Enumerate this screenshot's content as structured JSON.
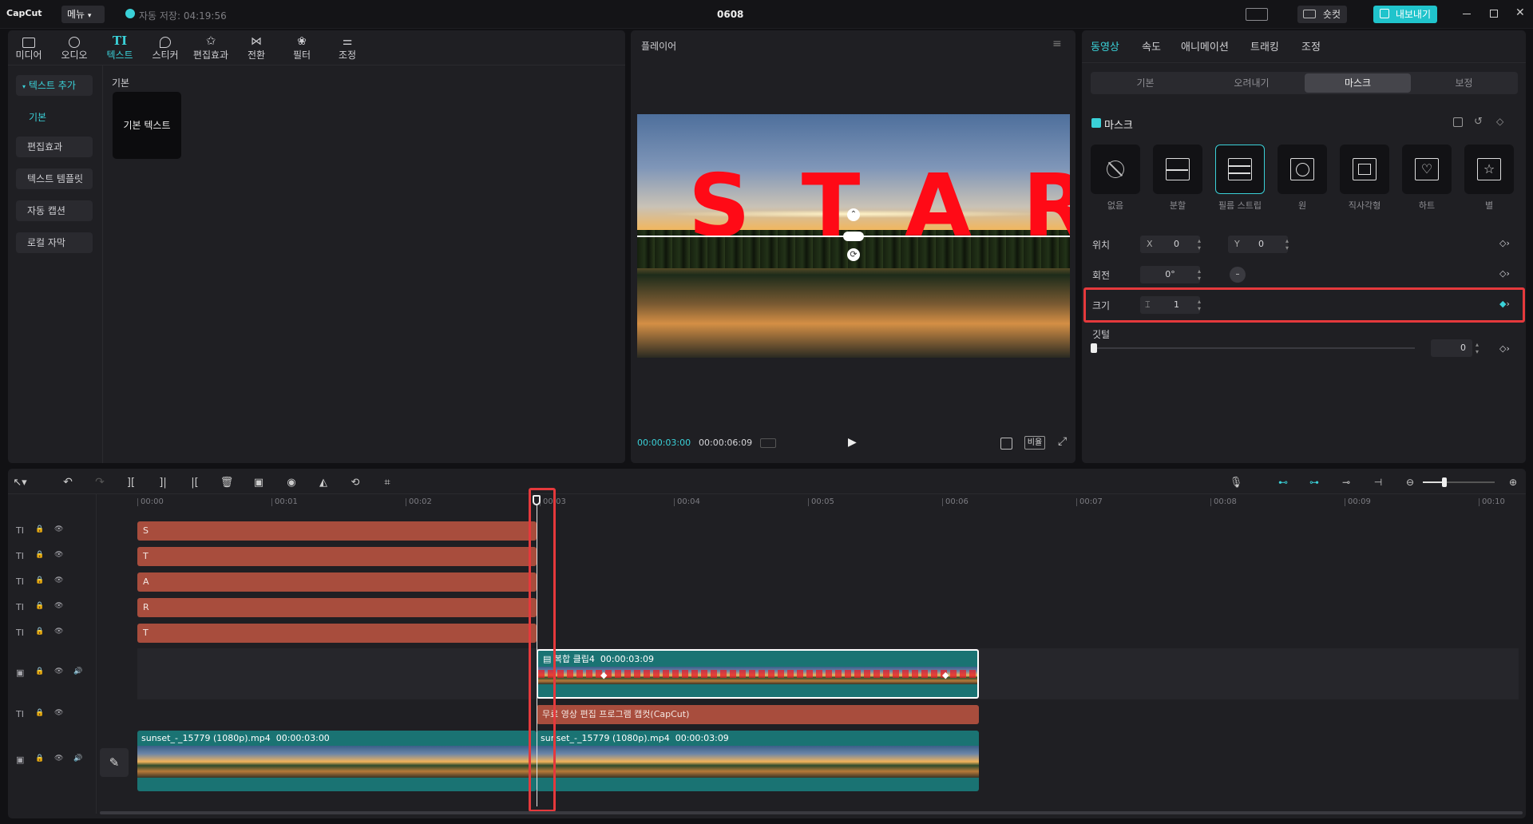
{
  "app": {
    "logo": "CapCut",
    "menu_label": "메뉴",
    "autosave": "자동 저장: 04:19:56",
    "project_title": "0608",
    "shortcut_label": "숏컷",
    "export_label": "내보내기"
  },
  "toolbar": [
    {
      "label": "미디어"
    },
    {
      "label": "오디오"
    },
    {
      "label": "텍스트"
    },
    {
      "label": "스티커"
    },
    {
      "label": "편집효과"
    },
    {
      "label": "전환"
    },
    {
      "label": "필터"
    },
    {
      "label": "조정"
    }
  ],
  "left_sidebar": {
    "items": [
      "텍스트 추가",
      "기본",
      "편집효과",
      "텍스트 템플릿",
      "자동 캡션",
      "로컬 자막"
    ]
  },
  "text_panel": {
    "section_title": "기본",
    "card_label": "기본 텍스트"
  },
  "player": {
    "title": "플레이어",
    "overlay_text": "START",
    "current_time": "00:00:03:00",
    "total_time": "00:00:06:09",
    "ratio_label": "비율"
  },
  "props": {
    "tabs": [
      "동영상",
      "속도",
      "애니메이션",
      "트래킹",
      "조정"
    ],
    "subtabs": [
      "기본",
      "오려내기",
      "마스크",
      "보정"
    ],
    "mask_title": "마스크",
    "shapes": [
      "없음",
      "분할",
      "필름 스트립",
      "원",
      "직사각형",
      "하트",
      "별"
    ],
    "position_label": "위치",
    "x_label": "X",
    "x_value": "0",
    "y_label": "Y",
    "y_value": "0",
    "rotation_label": "회전",
    "rotation_value": "0°",
    "size_label": "크기",
    "size_value": "1",
    "feather_label": "깃털",
    "feather_value": "0"
  },
  "timeline": {
    "ruler": [
      "00:00",
      "00:01",
      "00:02",
      "00:03",
      "00:04",
      "00:05",
      "00:06",
      "00:07",
      "00:08",
      "00:09",
      "00:10"
    ],
    "text_clips": [
      "S",
      "T",
      "A",
      "R",
      "T"
    ],
    "compound_label": "복합 클립4",
    "compound_duration": "00:00:03:09",
    "subtitle_clip": "무료 영상 편집 프로그램 캡컷(CapCut)",
    "video1_name": "sunset_-_15779 (1080p).mp4",
    "video1_duration": "00:00:03:00",
    "video2_name": "sunset_-_15779 (1080p).mp4",
    "video2_duration": "00:00:03:09",
    "playhead_time": "00:00:03:00"
  },
  "colors": {
    "accent": "#3ad1d8",
    "highlight": "#e5393c",
    "text_clip": "#a84d3d",
    "video_track": "#1a7373"
  }
}
